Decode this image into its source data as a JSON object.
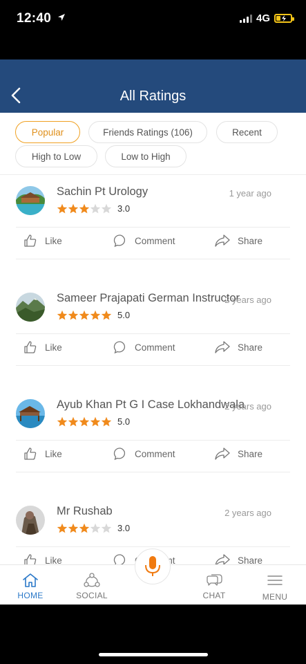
{
  "status_bar": {
    "time": "12:40",
    "network": "4G",
    "battery_level": 0.3
  },
  "header": {
    "title": "All Ratings"
  },
  "filters": [
    {
      "label": "Popular",
      "active": true
    },
    {
      "label": "Friends Ratings (106)",
      "active": false
    },
    {
      "label": "Recent",
      "active": false
    },
    {
      "label": "High to Low",
      "active": false
    },
    {
      "label": "Low to High",
      "active": false
    }
  ],
  "reviews": [
    {
      "name": "Sachin Pt Urology",
      "time": "1 year ago",
      "rating": "3.0",
      "stars": 3
    },
    {
      "name": "Sameer Prajapati German Instructor",
      "time": "2 years ago",
      "rating": "5.0",
      "stars": 5
    },
    {
      "name": "Ayub Khan Pt G I Case Lokhandwala",
      "time": "2 years ago",
      "rating": "5.0",
      "stars": 5
    },
    {
      "name": "Mr Rushab",
      "time": "2 years ago",
      "rating": "3.0",
      "stars": 3
    }
  ],
  "actions": {
    "like": "Like",
    "comment": "Comment",
    "share": "Share"
  },
  "tabbar": {
    "home": "HOME",
    "social": "SOCIAL",
    "chat": "CHAT",
    "menu": "MENU"
  },
  "colors": {
    "header_bg": "#244a7c",
    "accent_orange": "#f0a020",
    "star_filled": "#f08a1c",
    "star_empty": "#d8d8d8",
    "active_tab": "#2a78c8"
  }
}
